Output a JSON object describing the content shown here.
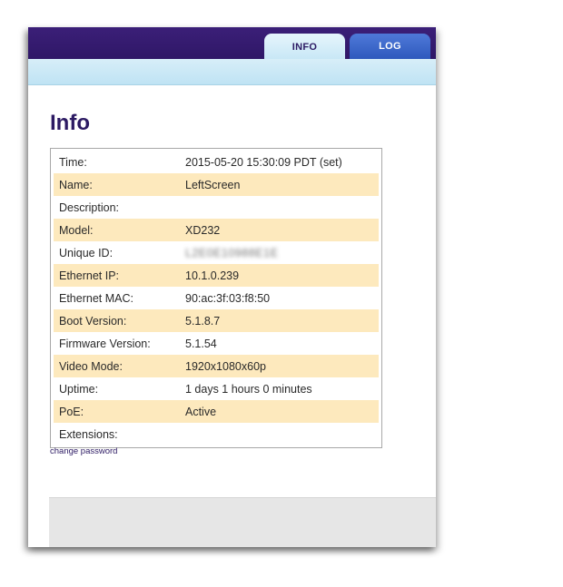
{
  "tabs": {
    "info_label": "INFO",
    "log_label": "LOG"
  },
  "page": {
    "title": "Info"
  },
  "rows": [
    {
      "label": "Time:",
      "value": "2015-05-20 15:30:09 PDT",
      "link": "(set)"
    },
    {
      "label": "Name:",
      "value": "LeftScreen"
    },
    {
      "label": "Description:",
      "value": ""
    },
    {
      "label": "Model:",
      "value": "XD232"
    },
    {
      "label": "Unique ID:",
      "value": "L2E0E10988E1E"
    },
    {
      "label": "Ethernet IP:",
      "value": "10.1.0.239"
    },
    {
      "label": "Ethernet MAC:",
      "value": "90:ac:3f:03:f8:50"
    },
    {
      "label": "Boot Version:",
      "value": "5.1.8.7"
    },
    {
      "label": "Firmware Version:",
      "value": "5.1.54"
    },
    {
      "label": "Video Mode:",
      "value": "1920x1080x60p"
    },
    {
      "label": "Uptime:",
      "value": "1 days 1 hours 0 minutes"
    },
    {
      "label": "PoE:",
      "value": "Active"
    },
    {
      "label": "Extensions:",
      "value": ""
    }
  ],
  "links": {
    "change_password": "change password"
  },
  "colors": {
    "header_purple": "#2f1767",
    "subbar_blue": "#c7e7f6",
    "row_highlight": "#fde9bd",
    "title_text": "#2c1a63"
  }
}
